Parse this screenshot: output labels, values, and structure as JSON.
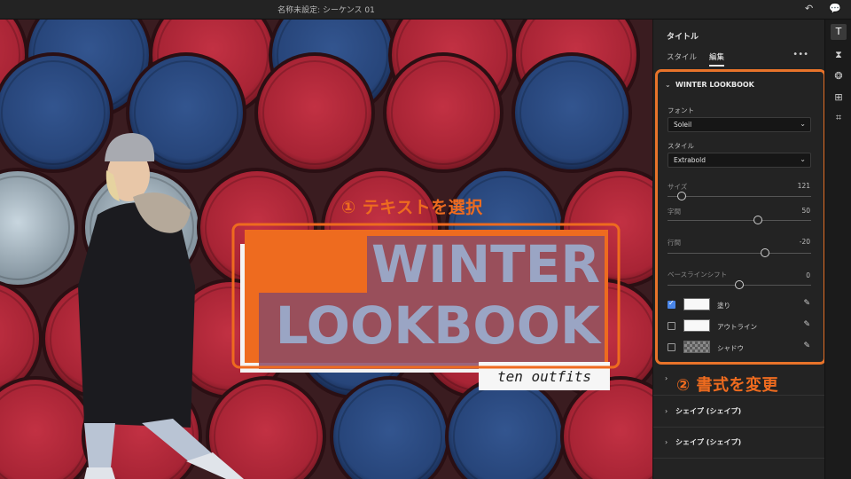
{
  "topbar": {
    "sequence_title": "名称未設定: シーケンス 01",
    "undo_icon": "undo-icon",
    "comment_icon": "comment-icon"
  },
  "viewer": {
    "title_line1": "WINTER",
    "title_line2": "LOOKBOOK",
    "subtitle": "ten outfits",
    "callout_select": "① テキストを選択",
    "callout_format": "② 書式を変更"
  },
  "panel": {
    "title": "タイトル",
    "tabs": [
      {
        "label": "スタイル",
        "active": false
      },
      {
        "label": "編集",
        "active": true
      }
    ],
    "more_icon": "•••",
    "section_title": "WINTER LOOKBOOK",
    "font": {
      "label": "フォント",
      "value": "Soleil"
    },
    "style": {
      "label": "スタイル",
      "value": "Extrabold"
    },
    "sliders": [
      {
        "label": "サイズ",
        "value": "121",
        "level": 0.1
      },
      {
        "label": "字間",
        "value": "50",
        "level": 0.63
      },
      {
        "label": "行間",
        "value": "-20",
        "level": 0.68
      },
      {
        "label": "ベースラインシフト",
        "value": "0",
        "level": 0.5
      }
    ],
    "appearance": [
      {
        "label": "塗り",
        "checked": true,
        "swatch": "white"
      },
      {
        "label": "アウトライン",
        "checked": false,
        "swatch": "white"
      },
      {
        "label": "シャドウ",
        "checked": false,
        "swatch": "checker"
      }
    ],
    "shape_sections": [
      "シェイプ (シェイプ)",
      "シェイプ (シェイプ)"
    ]
  },
  "rail": {
    "icons": [
      "title-tool-icon",
      "transition-icon",
      "color-icon",
      "layout-icon",
      "crop-icon"
    ]
  },
  "colors": {
    "accent_orange": "#ee6b1f",
    "barrel_red": "#b8283a",
    "barrel_blue": "#2b4a86",
    "text_overlay": "#9aa5c4"
  }
}
